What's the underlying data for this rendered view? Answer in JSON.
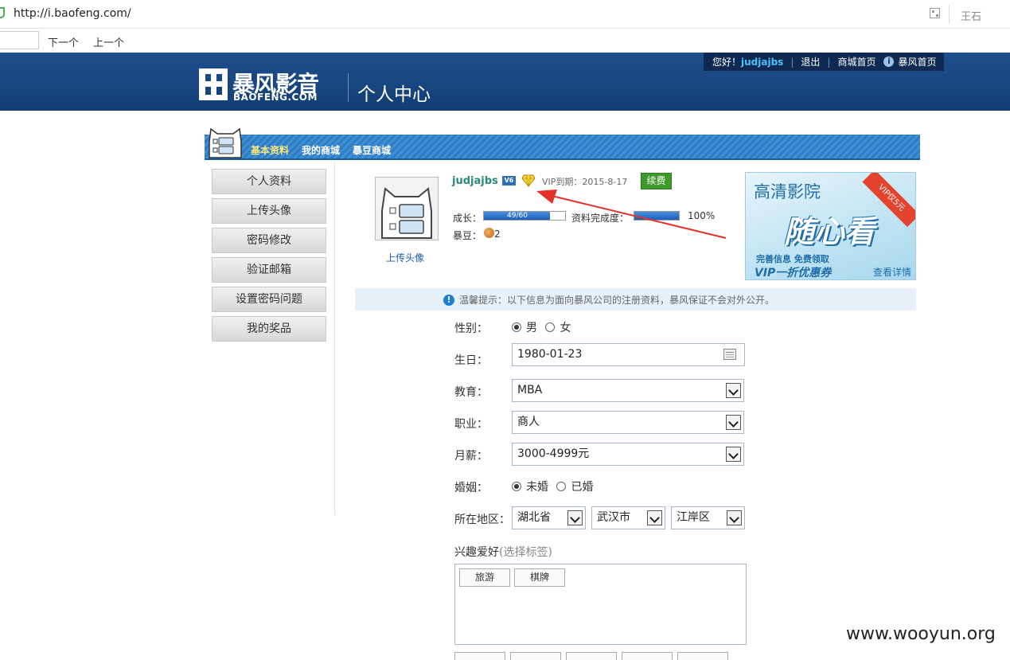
{
  "browser": {
    "url": "http://i.baofeng.com/",
    "user": "王石",
    "find_next": "下一个",
    "find_prev": "上一个"
  },
  "header": {
    "logo_cn": "暴风影音",
    "logo_en": "BAOFENG.COM",
    "title": "个人中心",
    "greeting": "您好！",
    "username": "judjajbs",
    "logout": "退出",
    "mall_home": "商城首页",
    "baofeng_home": "暴风首页"
  },
  "tabs": [
    "基本资料",
    "我的商城",
    "暴豆商城"
  ],
  "sidebar": [
    "个人资料",
    "上传头像",
    "密码修改",
    "验证邮箱",
    "设置密码问题",
    "我的奖品"
  ],
  "profile": {
    "username": "judjajbs",
    "vip_text": "VIP到期：2015-8-17",
    "renew_label": "续费",
    "upload_avatar": "上传头像",
    "growth_label": "成长：",
    "growth_text": "49/60",
    "growth_fraction": 0.8167,
    "completeness_label": "资料完成度：",
    "completeness_pct": "100%",
    "bean_label": "暴豆：",
    "bean_value": "2"
  },
  "ad": {
    "line1": "高清影院",
    "line2": "随心看",
    "line3": "完善信息 免费领取",
    "line4": "VIP一折优惠券",
    "details": "查看详情",
    "corner": "VIP仅5元"
  },
  "notice": "温馨提示：以下信息为面向暴风公司的注册资料，暴风保证不会对外公开。",
  "form": {
    "gender": {
      "label": "性别：",
      "options": [
        "男",
        "女"
      ],
      "selected": 0
    },
    "birthday": {
      "label": "生日：",
      "value": "1980-01-23"
    },
    "education": {
      "label": "教育：",
      "value": "MBA"
    },
    "job": {
      "label": "职业：",
      "value": "商人"
    },
    "salary": {
      "label": "月薪：",
      "value": "3000-4999元"
    },
    "marriage": {
      "label": "婚姻：",
      "options": [
        "未婚",
        "已婚"
      ],
      "selected": 0
    },
    "region": {
      "label": "所在地区：",
      "province": "湖北省",
      "city": "武汉市",
      "district": "江岸区"
    },
    "hobby": {
      "label": "兴趣爱好",
      "hint": "(选择标签)",
      "tags": [
        "旅游",
        "棋牌"
      ]
    }
  },
  "watermark": "www.wooyun.org"
}
